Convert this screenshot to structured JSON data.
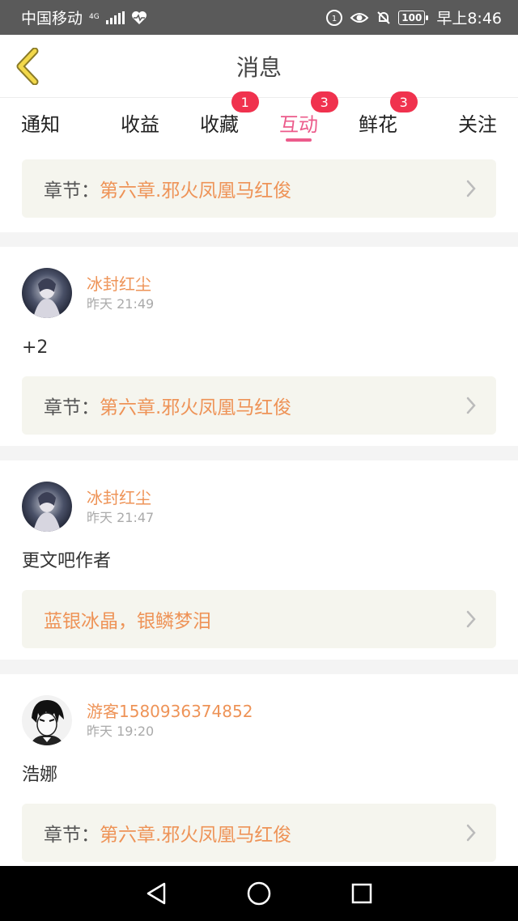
{
  "status_bar": {
    "carrier": "中国移动",
    "network": "4G",
    "battery": "100",
    "time": "早上8:46"
  },
  "header": {
    "title": "消息"
  },
  "tabs": [
    {
      "label": "通知",
      "badge": ""
    },
    {
      "label": "收益",
      "badge": ""
    },
    {
      "label": "收藏",
      "badge": "1"
    },
    {
      "label": "互动",
      "badge": "3",
      "active": true
    },
    {
      "label": "鲜花",
      "badge": "3"
    },
    {
      "label": "关注",
      "badge": ""
    }
  ],
  "messages": [
    {
      "chapter_label": "章节：",
      "chapter_value": "第六章.邪火凤凰马红俊"
    },
    {
      "user": "冰封红尘",
      "time": "昨天 21:49",
      "comment": "+2",
      "chapter_label": "章节：",
      "chapter_value": "第六章.邪火凤凰马红俊"
    },
    {
      "user": "冰封红尘",
      "time": "昨天 21:47",
      "comment": "更文吧作者",
      "chapter_label": "",
      "chapter_value": "蓝银冰晶，银鳞梦泪"
    },
    {
      "user": "游客1580936374852",
      "time": "昨天 19:20",
      "comment": "浩娜",
      "chapter_label": "章节：",
      "chapter_value": "第六章.邪火凤凰马红俊"
    }
  ],
  "colors": {
    "accent": "#ec5b8b",
    "link": "#ee9357",
    "badge": "#f0324e"
  },
  "icons": {
    "back": "chevron-left-icon",
    "more": "chevron-right-icon",
    "nav_back": "triangle-back-icon",
    "nav_home": "circle-home-icon",
    "nav_recent": "square-recent-icon"
  }
}
